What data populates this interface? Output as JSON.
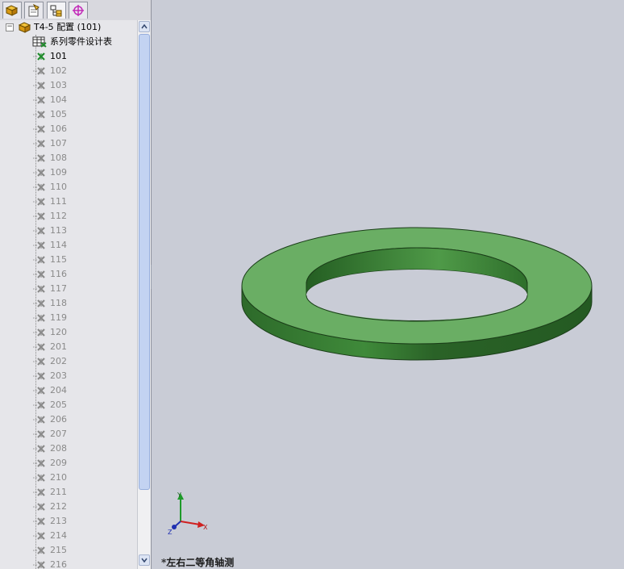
{
  "tree": {
    "root_label": "T4-5 配置  (101)",
    "design_table_label": "系列零件设计表",
    "configs": [
      "101",
      "102",
      "103",
      "104",
      "105",
      "106",
      "107",
      "108",
      "109",
      "110",
      "111",
      "112",
      "113",
      "114",
      "115",
      "116",
      "117",
      "118",
      "119",
      "120",
      "201",
      "202",
      "203",
      "204",
      "205",
      "206",
      "207",
      "208",
      "209",
      "210",
      "211",
      "212",
      "213",
      "214",
      "215",
      "216"
    ],
    "active_config": "101"
  },
  "tabs": [
    "feature-manager",
    "property-manager",
    "configuration-manager",
    "dimxpert-manager"
  ],
  "triad": {
    "x": "X",
    "y": "Y",
    "z": "Z"
  },
  "view_label": "*左右二等角轴测",
  "colors": {
    "part_face": "#6aae64",
    "part_side": "#2f6b2c",
    "background": "#c9ccd6"
  }
}
